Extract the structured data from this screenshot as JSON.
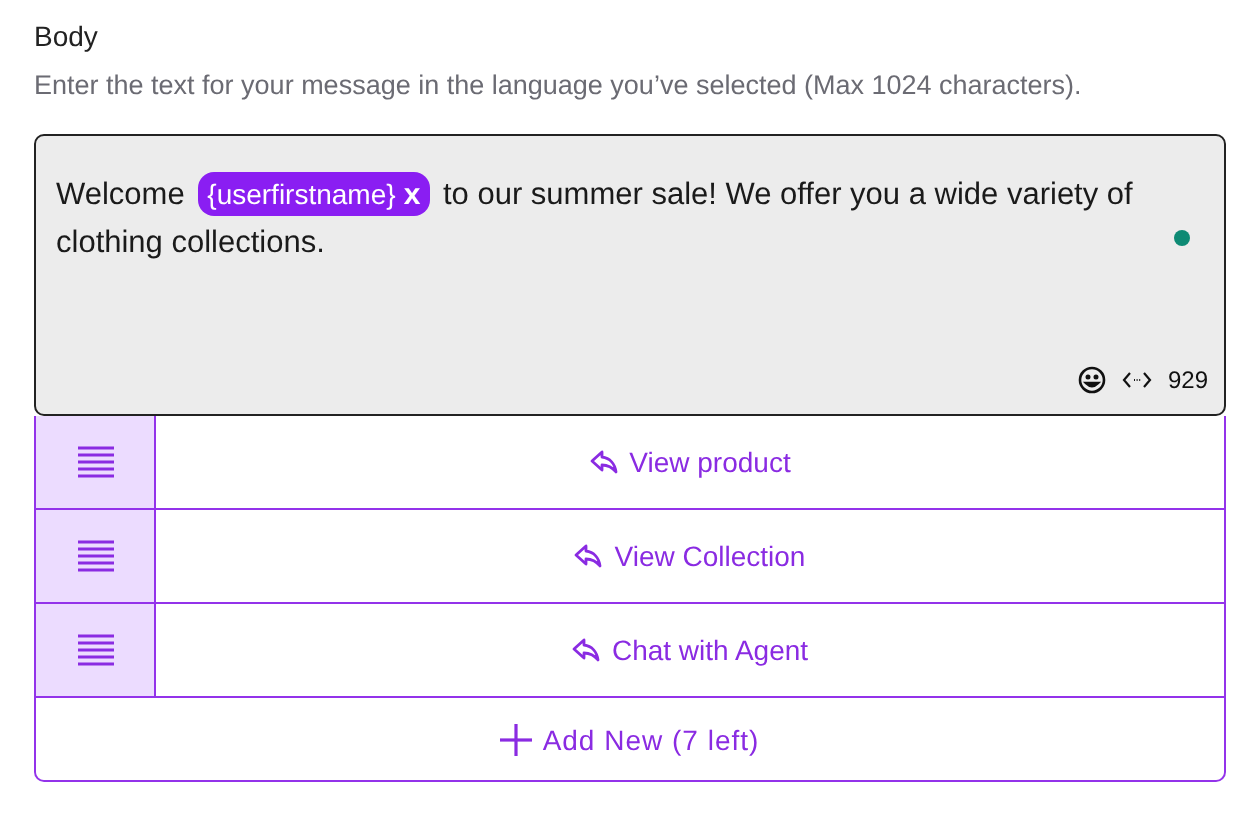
{
  "label": "Body",
  "hint": "Enter the text for your message in the language you’ve selected (Max 1024 characters).",
  "message": {
    "parts": [
      {
        "kind": "text",
        "text": "Welcome"
      },
      {
        "kind": "tag",
        "text": "{userfirstname}",
        "remove": "x"
      },
      {
        "kind": "text",
        "text": "to our summer sale! We offer you a wide variety of"
      },
      {
        "kind": "line",
        "text": "clothing collections."
      }
    ],
    "count": "929"
  },
  "buttons": [
    {
      "label": "View product"
    },
    {
      "label": "View Collection"
    },
    {
      "label": "Chat with Agent"
    }
  ],
  "add_button": "Add New (7 left)"
}
